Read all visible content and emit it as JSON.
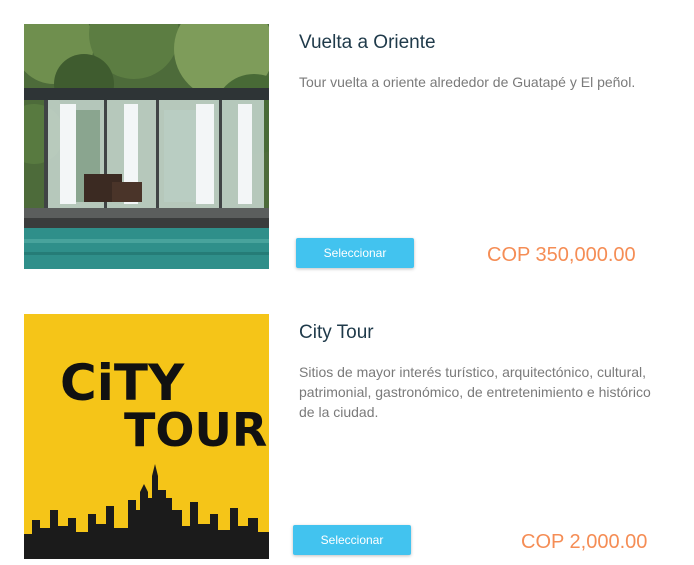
{
  "products": [
    {
      "title": "Vuelta a Oriente",
      "description": "Tour vuelta a oriente alrededor de Guatapé y El peñol.",
      "button_label": "Seleccionar",
      "price": "COP 350,000.00"
    },
    {
      "title": "City Tour",
      "description": "Sitios de mayor interés turístico, arquitectónico, cultural, patrimonial, gastronómico, de entretenimiento e histórico de la ciudad.",
      "button_label": "Seleccionar",
      "price": "COP 2,000.00",
      "logo_text_line1": "CiTY",
      "logo_text_line2": "TOUR"
    }
  ],
  "colors": {
    "button": "#42c3ef",
    "price": "#f58d55",
    "title": "#1f3a4a",
    "description": "#7a7a7a",
    "city_tour_bg": "#f5c518"
  }
}
